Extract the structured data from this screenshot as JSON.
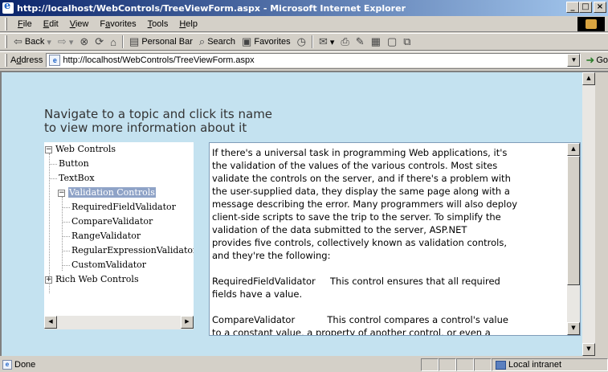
{
  "window": {
    "title": "http://localhost/WebControls/TreeViewForm.aspx - Microsoft Internet Explorer",
    "minimize": "_",
    "maximize": "□",
    "close": "×"
  },
  "menubar": {
    "items": [
      {
        "u": "F",
        "rest": "ile"
      },
      {
        "u": "E",
        "rest": "dit"
      },
      {
        "u": "V",
        "rest": "iew"
      },
      {
        "pre": "F",
        "u": "a",
        "rest": "vorites"
      },
      {
        "u": "T",
        "rest": "ools"
      },
      {
        "u": "H",
        "rest": "elp"
      }
    ]
  },
  "toolbar": {
    "back": "Back",
    "personal_bar": "Personal Bar",
    "search": "Search",
    "favorites": "Favorites"
  },
  "address": {
    "label_pre": "A",
    "label_u": "d",
    "label_rest": "dress",
    "url": "http://localhost/WebControls/TreeViewForm.aspx",
    "go": "Go"
  },
  "page": {
    "headline_1": "Navigate to a topic and click its name",
    "headline_2": "to view more information about it",
    "tree": {
      "web_controls": "Web Controls",
      "button": "Button",
      "textbox": "TextBox",
      "validation_controls": "Validation Controls",
      "required": "RequiredFieldValidator",
      "compare": "CompareValidator",
      "range": "RangeValidator",
      "regex": "RegularExpressionValidator",
      "custom": "CustomValidator",
      "rich": "Rich Web Controls"
    },
    "description": "If there's a universal task in programming Web applications, it's\nthe validation of the values of the various controls. Most sites\nvalidate the controls on the server, and if there's a problem with\nthe user-supplied data, they display the same page along with a\nmessage describing the error. Many programmers will also deploy\nclient-side scripts to save the trip to the server. To simplify the\nvalidation of the data submitted to the server, ASP.NET\nprovides five controls, collectively known as validation controls,\nand they're the following:\n\nRequiredFieldValidator     This control ensures that all required\nfields have a value.\n\nCompareValidator           This control compares a control's value\nto a constant value, a property of another control, or even a"
  },
  "status": {
    "text": "Done",
    "zone": "Local intranet"
  }
}
